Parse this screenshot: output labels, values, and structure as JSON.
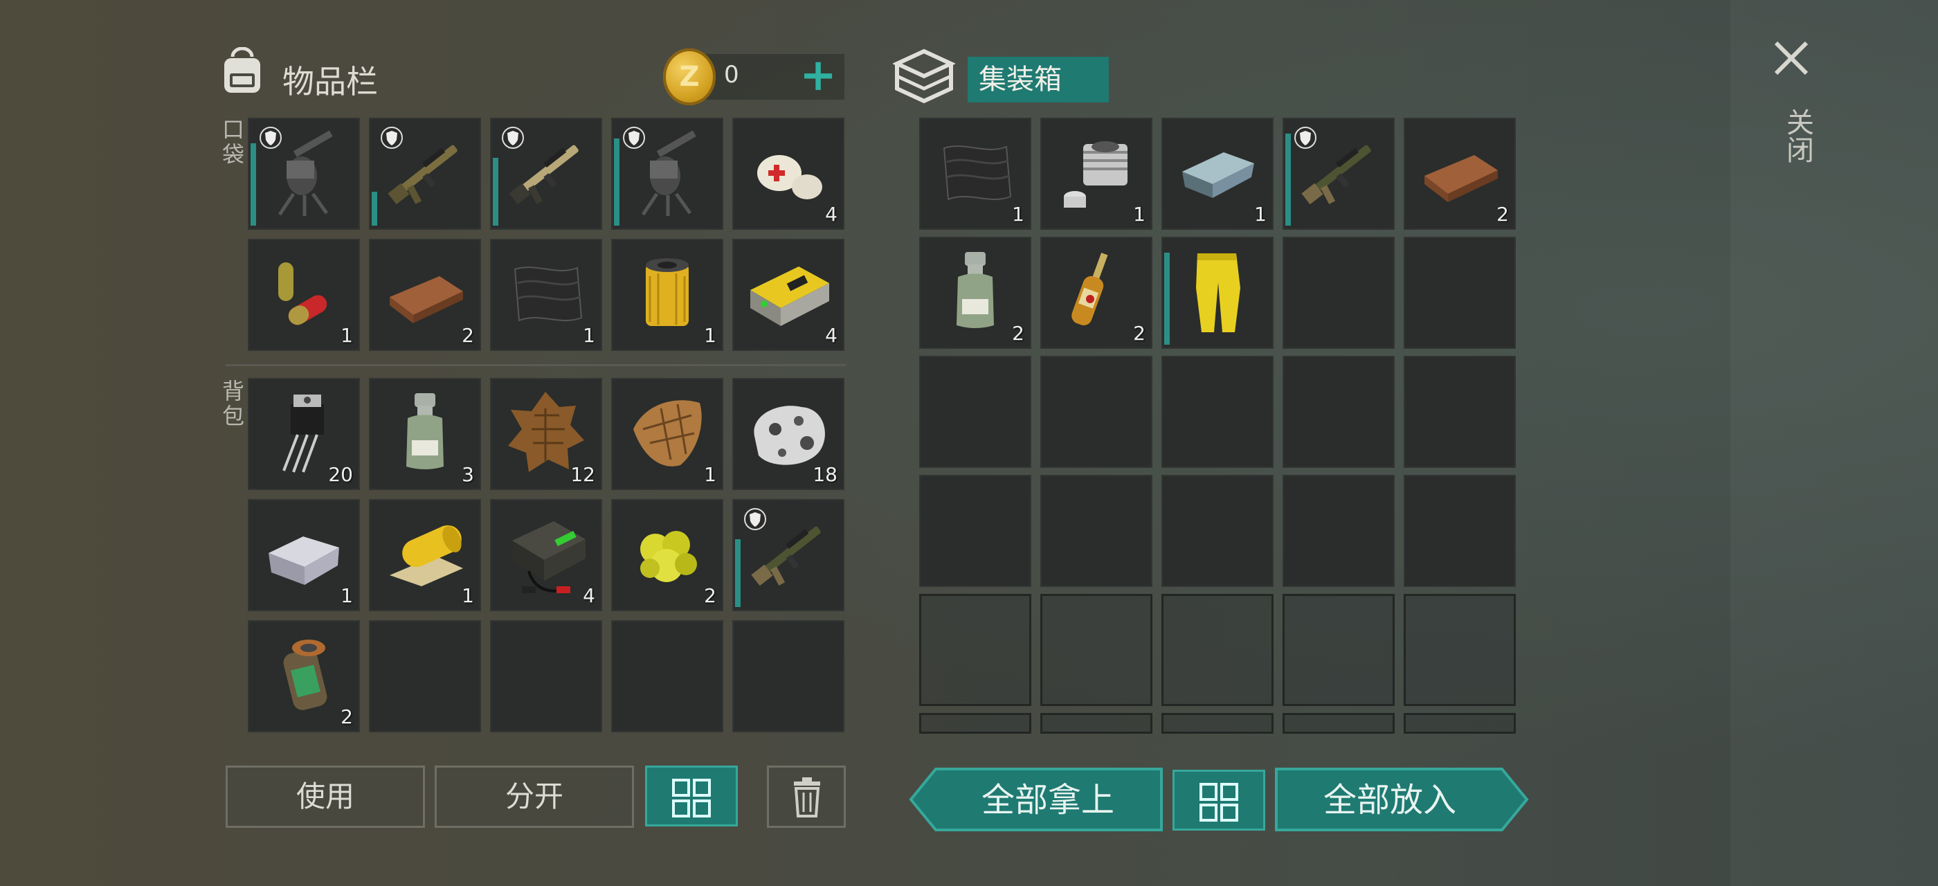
{
  "inventory": {
    "title": "物品栏",
    "coins": "0",
    "pocket_label": "口袋",
    "backpack_label": "背包",
    "pocket": [
      {
        "icon": "sentry-turret-icon",
        "count": "",
        "dur": 0.85,
        "prot": true
      },
      {
        "icon": "assault-rifle-icon",
        "count": "",
        "dur": 0.35,
        "prot": true
      },
      {
        "icon": "bullpup-rifle-icon",
        "count": "",
        "dur": 0.7,
        "prot": true
      },
      {
        "icon": "sentry-turret-icon",
        "count": "",
        "dur": 0.9,
        "prot": true
      },
      {
        "icon": "bandage-icon",
        "count": "4"
      },
      {
        "icon": "pill-capsule-icon",
        "count": "1"
      },
      {
        "icon": "wooden-plank-icon",
        "count": "2"
      },
      {
        "icon": "carbon-fiber-sheet-icon",
        "count": "1"
      },
      {
        "icon": "oil-filter-icon",
        "count": "1"
      },
      {
        "icon": "battery-pack-icon",
        "count": "4"
      }
    ],
    "backpack": [
      {
        "icon": "transistor-icon",
        "count": "20"
      },
      {
        "icon": "acid-bottle-icon",
        "count": "3"
      },
      {
        "icon": "reptile-skin-icon",
        "count": "12"
      },
      {
        "icon": "leather-icon",
        "count": "1"
      },
      {
        "icon": "ore-rock-icon",
        "count": "18"
      },
      {
        "icon": "aluminum-ingot-icon",
        "count": "1"
      },
      {
        "icon": "yellow-fabric-roll-icon",
        "count": "1"
      },
      {
        "icon": "car-battery-icon",
        "count": "4"
      },
      {
        "icon": "sulfur-crystal-icon",
        "count": "2"
      },
      {
        "icon": "sniper-rifle-icon",
        "count": "",
        "dur": 0.7,
        "prot": true
      },
      {
        "icon": "canister-icon",
        "count": "2"
      },
      {
        "icon": "",
        "count": ""
      },
      {
        "icon": "",
        "count": ""
      },
      {
        "icon": "",
        "count": ""
      },
      {
        "icon": "",
        "count": ""
      }
    ],
    "buttons": {
      "use": "使用",
      "split": "分开"
    }
  },
  "container": {
    "title": "集装箱",
    "row1": [
      {
        "icon": "carbon-fiber-sheet-icon",
        "count": "1"
      },
      {
        "icon": "engine-cylinder-icon",
        "count": "1"
      },
      {
        "icon": "steel-ingot-icon",
        "count": "1"
      },
      {
        "icon": "sniper-rifle-icon",
        "count": "",
        "dur": 0.95,
        "prot": true
      },
      {
        "icon": "wooden-plank-icon",
        "count": "2"
      }
    ],
    "row2": [
      {
        "icon": "acid-bottle-icon",
        "count": "2"
      },
      {
        "icon": "ampoule-icon",
        "count": "2"
      },
      {
        "icon": "yellow-pants-icon",
        "count": "",
        "dur": 0.95
      },
      {
        "icon": "",
        "count": ""
      },
      {
        "icon": "",
        "count": ""
      }
    ],
    "buttons": {
      "take_all": "全部拿上",
      "put_all": "全部放入"
    }
  },
  "close_label": "关闭",
  "colors": {
    "accent": "#1f7a72",
    "accent_border": "#36a89c",
    "slot": "#2a2d2b",
    "durability": "#2b8f86"
  }
}
